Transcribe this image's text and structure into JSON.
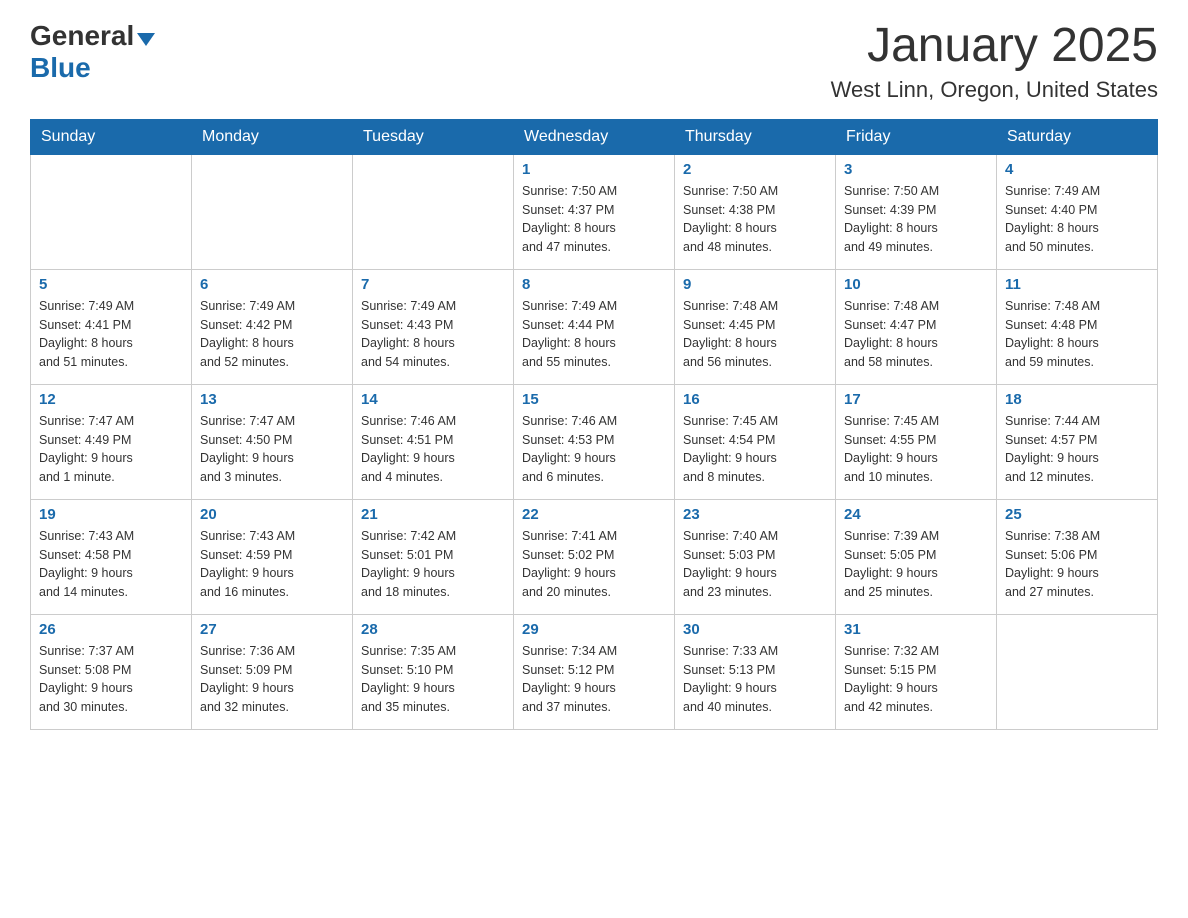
{
  "header": {
    "logo_general": "General",
    "logo_blue": "Blue",
    "title": "January 2025",
    "subtitle": "West Linn, Oregon, United States"
  },
  "days_of_week": [
    "Sunday",
    "Monday",
    "Tuesday",
    "Wednesday",
    "Thursday",
    "Friday",
    "Saturday"
  ],
  "weeks": [
    [
      {
        "day": "",
        "info": ""
      },
      {
        "day": "",
        "info": ""
      },
      {
        "day": "",
        "info": ""
      },
      {
        "day": "1",
        "info": "Sunrise: 7:50 AM\nSunset: 4:37 PM\nDaylight: 8 hours\nand 47 minutes."
      },
      {
        "day": "2",
        "info": "Sunrise: 7:50 AM\nSunset: 4:38 PM\nDaylight: 8 hours\nand 48 minutes."
      },
      {
        "day": "3",
        "info": "Sunrise: 7:50 AM\nSunset: 4:39 PM\nDaylight: 8 hours\nand 49 minutes."
      },
      {
        "day": "4",
        "info": "Sunrise: 7:49 AM\nSunset: 4:40 PM\nDaylight: 8 hours\nand 50 minutes."
      }
    ],
    [
      {
        "day": "5",
        "info": "Sunrise: 7:49 AM\nSunset: 4:41 PM\nDaylight: 8 hours\nand 51 minutes."
      },
      {
        "day": "6",
        "info": "Sunrise: 7:49 AM\nSunset: 4:42 PM\nDaylight: 8 hours\nand 52 minutes."
      },
      {
        "day": "7",
        "info": "Sunrise: 7:49 AM\nSunset: 4:43 PM\nDaylight: 8 hours\nand 54 minutes."
      },
      {
        "day": "8",
        "info": "Sunrise: 7:49 AM\nSunset: 4:44 PM\nDaylight: 8 hours\nand 55 minutes."
      },
      {
        "day": "9",
        "info": "Sunrise: 7:48 AM\nSunset: 4:45 PM\nDaylight: 8 hours\nand 56 minutes."
      },
      {
        "day": "10",
        "info": "Sunrise: 7:48 AM\nSunset: 4:47 PM\nDaylight: 8 hours\nand 58 minutes."
      },
      {
        "day": "11",
        "info": "Sunrise: 7:48 AM\nSunset: 4:48 PM\nDaylight: 8 hours\nand 59 minutes."
      }
    ],
    [
      {
        "day": "12",
        "info": "Sunrise: 7:47 AM\nSunset: 4:49 PM\nDaylight: 9 hours\nand 1 minute."
      },
      {
        "day": "13",
        "info": "Sunrise: 7:47 AM\nSunset: 4:50 PM\nDaylight: 9 hours\nand 3 minutes."
      },
      {
        "day": "14",
        "info": "Sunrise: 7:46 AM\nSunset: 4:51 PM\nDaylight: 9 hours\nand 4 minutes."
      },
      {
        "day": "15",
        "info": "Sunrise: 7:46 AM\nSunset: 4:53 PM\nDaylight: 9 hours\nand 6 minutes."
      },
      {
        "day": "16",
        "info": "Sunrise: 7:45 AM\nSunset: 4:54 PM\nDaylight: 9 hours\nand 8 minutes."
      },
      {
        "day": "17",
        "info": "Sunrise: 7:45 AM\nSunset: 4:55 PM\nDaylight: 9 hours\nand 10 minutes."
      },
      {
        "day": "18",
        "info": "Sunrise: 7:44 AM\nSunset: 4:57 PM\nDaylight: 9 hours\nand 12 minutes."
      }
    ],
    [
      {
        "day": "19",
        "info": "Sunrise: 7:43 AM\nSunset: 4:58 PM\nDaylight: 9 hours\nand 14 minutes."
      },
      {
        "day": "20",
        "info": "Sunrise: 7:43 AM\nSunset: 4:59 PM\nDaylight: 9 hours\nand 16 minutes."
      },
      {
        "day": "21",
        "info": "Sunrise: 7:42 AM\nSunset: 5:01 PM\nDaylight: 9 hours\nand 18 minutes."
      },
      {
        "day": "22",
        "info": "Sunrise: 7:41 AM\nSunset: 5:02 PM\nDaylight: 9 hours\nand 20 minutes."
      },
      {
        "day": "23",
        "info": "Sunrise: 7:40 AM\nSunset: 5:03 PM\nDaylight: 9 hours\nand 23 minutes."
      },
      {
        "day": "24",
        "info": "Sunrise: 7:39 AM\nSunset: 5:05 PM\nDaylight: 9 hours\nand 25 minutes."
      },
      {
        "day": "25",
        "info": "Sunrise: 7:38 AM\nSunset: 5:06 PM\nDaylight: 9 hours\nand 27 minutes."
      }
    ],
    [
      {
        "day": "26",
        "info": "Sunrise: 7:37 AM\nSunset: 5:08 PM\nDaylight: 9 hours\nand 30 minutes."
      },
      {
        "day": "27",
        "info": "Sunrise: 7:36 AM\nSunset: 5:09 PM\nDaylight: 9 hours\nand 32 minutes."
      },
      {
        "day": "28",
        "info": "Sunrise: 7:35 AM\nSunset: 5:10 PM\nDaylight: 9 hours\nand 35 minutes."
      },
      {
        "day": "29",
        "info": "Sunrise: 7:34 AM\nSunset: 5:12 PM\nDaylight: 9 hours\nand 37 minutes."
      },
      {
        "day": "30",
        "info": "Sunrise: 7:33 AM\nSunset: 5:13 PM\nDaylight: 9 hours\nand 40 minutes."
      },
      {
        "day": "31",
        "info": "Sunrise: 7:32 AM\nSunset: 5:15 PM\nDaylight: 9 hours\nand 42 minutes."
      },
      {
        "day": "",
        "info": ""
      }
    ]
  ]
}
